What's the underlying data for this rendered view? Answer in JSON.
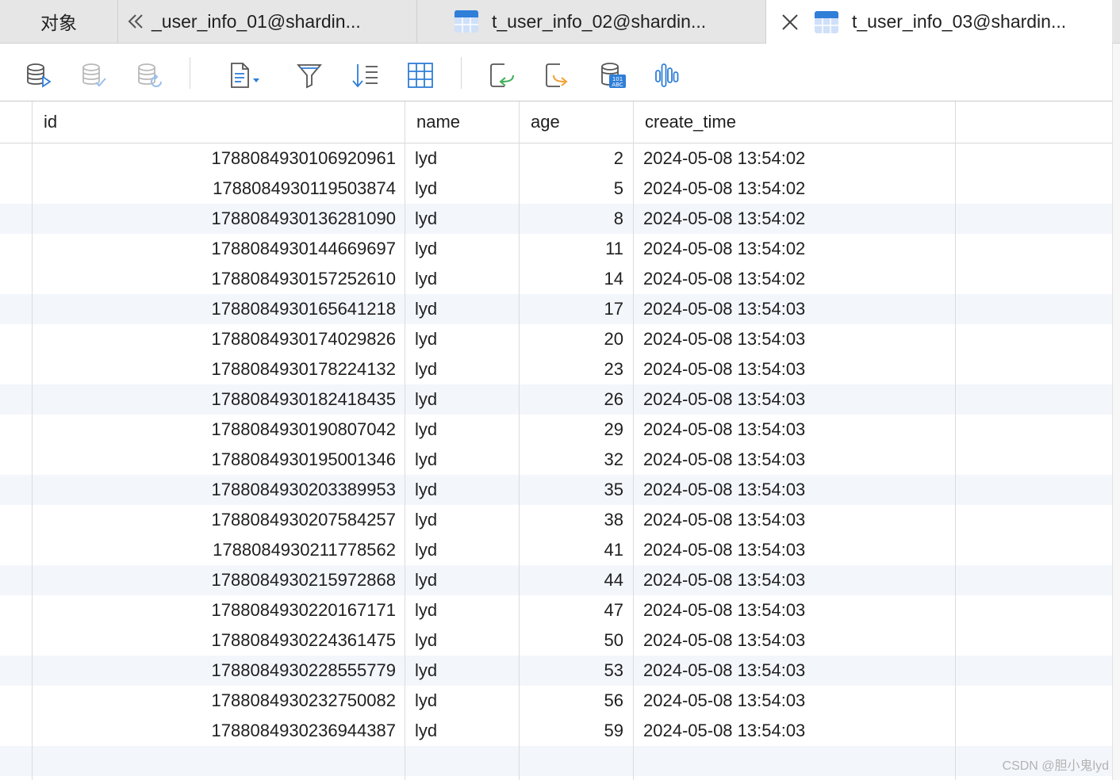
{
  "tabs": [
    {
      "label": "对象",
      "active": false
    },
    {
      "label": "_user_info_01@shardin...",
      "active": false
    },
    {
      "label": "t_user_info_02@shardin...",
      "active": false
    },
    {
      "label": "t_user_info_03@shardin...",
      "active": true
    }
  ],
  "toolbar": {
    "tools": [
      "db-run-icon",
      "db-check-icon",
      "db-refresh-icon",
      "document-dropdown-icon",
      "filter-icon",
      "sort-icon",
      "grid-icon",
      "import-icon",
      "export-icon",
      "db-text-icon",
      "waveform-icon"
    ]
  },
  "colors": {
    "accent": "#2f7ed8",
    "green": "#3fae57",
    "orange": "#f2a035",
    "row_alt": "#f3f6fb"
  },
  "table": {
    "columns": [
      "id",
      "name",
      "age",
      "create_time"
    ],
    "rows": [
      [
        "1788084930106920961",
        "lyd",
        "2",
        "2024-05-08 13:54:02"
      ],
      [
        "1788084930119503874",
        "lyd",
        "5",
        "2024-05-08 13:54:02"
      ],
      [
        "1788084930136281090",
        "lyd",
        "8",
        "2024-05-08 13:54:02"
      ],
      [
        "1788084930144669697",
        "lyd",
        "11",
        "2024-05-08 13:54:02"
      ],
      [
        "1788084930157252610",
        "lyd",
        "14",
        "2024-05-08 13:54:02"
      ],
      [
        "1788084930165641218",
        "lyd",
        "17",
        "2024-05-08 13:54:03"
      ],
      [
        "1788084930174029826",
        "lyd",
        "20",
        "2024-05-08 13:54:03"
      ],
      [
        "1788084930178224132",
        "lyd",
        "23",
        "2024-05-08 13:54:03"
      ],
      [
        "1788084930182418435",
        "lyd",
        "26",
        "2024-05-08 13:54:03"
      ],
      [
        "1788084930190807042",
        "lyd",
        "29",
        "2024-05-08 13:54:03"
      ],
      [
        "1788084930195001346",
        "lyd",
        "32",
        "2024-05-08 13:54:03"
      ],
      [
        "1788084930203389953",
        "lyd",
        "35",
        "2024-05-08 13:54:03"
      ],
      [
        "1788084930207584257",
        "lyd",
        "38",
        "2024-05-08 13:54:03"
      ],
      [
        "1788084930211778562",
        "lyd",
        "41",
        "2024-05-08 13:54:03"
      ],
      [
        "1788084930215972868",
        "lyd",
        "44",
        "2024-05-08 13:54:03"
      ],
      [
        "1788084930220167171",
        "lyd",
        "47",
        "2024-05-08 13:54:03"
      ],
      [
        "1788084930224361475",
        "lyd",
        "50",
        "2024-05-08 13:54:03"
      ],
      [
        "1788084930228555779",
        "lyd",
        "53",
        "2024-05-08 13:54:03"
      ],
      [
        "1788084930232750082",
        "lyd",
        "56",
        "2024-05-08 13:54:03"
      ],
      [
        "1788084930236944387",
        "lyd",
        "59",
        "2024-05-08 13:54:03"
      ]
    ]
  },
  "watermark": "CSDN @胆小鬼lyd"
}
